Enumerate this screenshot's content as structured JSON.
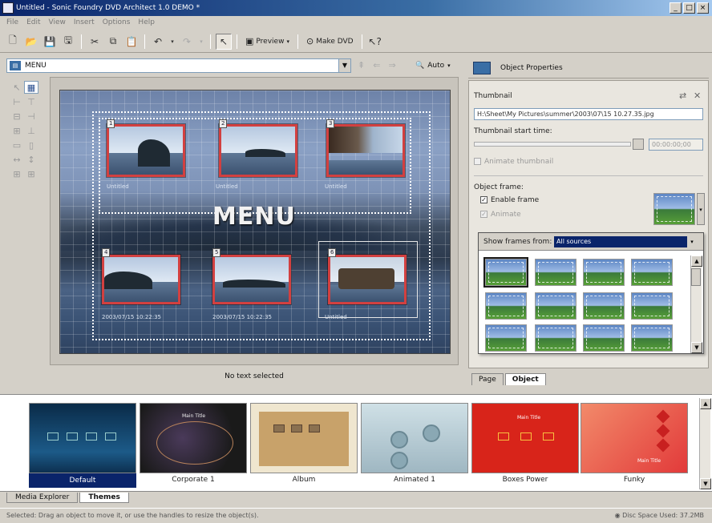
{
  "window": {
    "title": "Untitled - Sonic Foundry DVD Architect 1.0 DEMO *"
  },
  "menubar": [
    "File",
    "Edit",
    "View",
    "Insert",
    "Options",
    "Help"
  ],
  "toolbar": {
    "preview_label": "Preview",
    "make_dvd_label": "Make DVD"
  },
  "menu_combo": {
    "value": "MENU"
  },
  "zoom": {
    "label": "Auto"
  },
  "canvas": {
    "title": "MENU",
    "numbers": [
      "1",
      "2",
      "3",
      "4",
      "5",
      "6"
    ],
    "captions": [
      "Untitled",
      "Untitled",
      "Untitled",
      "2003/07/15 10:22:35",
      "2003/07/15 10:22:35",
      "Untitled"
    ]
  },
  "status_selected": "No text selected",
  "properties": {
    "header": "Object Properties",
    "thumbnail_label": "Thumbnail",
    "thumbnail_path": "H:\\Sheet\\My Pictures\\summer\\2003\\07\\15 10.27.35.jpg",
    "start_time_label": "Thumbnail start time:",
    "start_time_value": "00:00:00;00",
    "animate_label": "Animate thumbnail",
    "object_frame_label": "Object frame:",
    "enable_frame_label": "Enable frame",
    "animate_frame_label": "Animate",
    "show_frames_label": "Show frames from:",
    "show_frames_value": "All sources"
  },
  "right_tabs": [
    "Page",
    "Object"
  ],
  "themes": [
    {
      "name": "Default"
    },
    {
      "name": "Corporate 1"
    },
    {
      "name": "Album"
    },
    {
      "name": "Animated 1"
    },
    {
      "name": "Boxes Power"
    },
    {
      "name": "Funky"
    }
  ],
  "theme_inner_texts": {
    "corporate": "Main Title",
    "funky": "Main Title",
    "boxes": "Main Title"
  },
  "bottom_tabs": [
    "Media Explorer",
    "Themes"
  ],
  "statusbar": {
    "left": "Selected: Drag an object to move it, or use the handles to resize the object(s).",
    "right": "Disc Space Used: 37.2MB"
  }
}
